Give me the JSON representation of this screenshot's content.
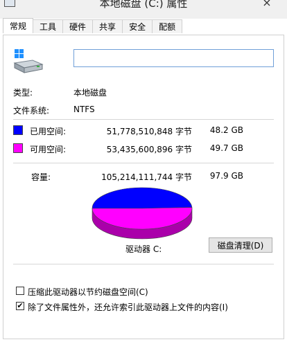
{
  "window": {
    "title": "本地磁盘 (C:) 属性",
    "close": "×"
  },
  "tabs": [
    "常规",
    "工具",
    "硬件",
    "共享",
    "安全",
    "配额"
  ],
  "general": {
    "name_value": "",
    "type_label": "类型:",
    "type_value": "本地磁盘",
    "fs_label": "文件系统:",
    "fs_value": "NTFS",
    "used_label": "已用空间:",
    "used_bytes": "51,778,510,848 字节",
    "used_size": "48.2 GB",
    "free_label": "可用空间:",
    "free_bytes": "53,435,600,896 字节",
    "free_size": "49.7 GB",
    "cap_label": "容量:",
    "cap_bytes": "105,214,111,744 字节",
    "cap_size": "97.9 GB",
    "drive_label": "驱动器 C:",
    "clean_button": "磁盘清理(D)",
    "compress_label": "压缩此驱动器以节约磁盘空间(C)",
    "compress_checked": false,
    "index_label": "除了文件属性外，还允许索引此驱动器上文件的内容(I)",
    "index_checked": true
  },
  "colors": {
    "used": "#0000ff",
    "free": "#ff00ff"
  },
  "chart_data": {
    "type": "pie",
    "categories": [
      "已用空间",
      "可用空间"
    ],
    "values": [
      48.2,
      49.7
    ]
  }
}
